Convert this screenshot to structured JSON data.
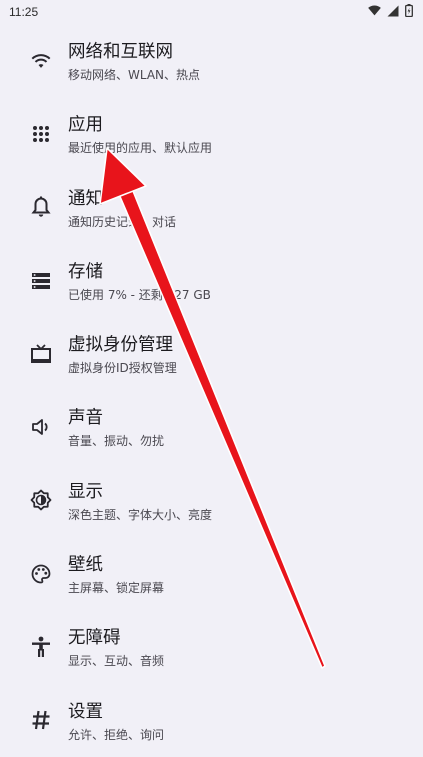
{
  "status_bar": {
    "time": "11:25"
  },
  "settings": [
    {
      "title": "网络和互联网",
      "subtitle": "移动网络、WLAN、热点",
      "icon": "wifi-icon"
    },
    {
      "title": "应用",
      "subtitle": "最近使用的应用、默认应用",
      "icon": "apps-grid-icon"
    },
    {
      "title": "通知",
      "subtitle": "通知历史记录、对话",
      "icon": "bell-icon"
    },
    {
      "title": "存储",
      "subtitle": "已使用 7% - 还剩 127 GB",
      "icon": "storage-icon"
    },
    {
      "title": "虚拟身份管理",
      "subtitle": "虚拟身份ID授权管理",
      "icon": "tv-icon"
    },
    {
      "title": "声音",
      "subtitle": "音量、振动、勿扰",
      "icon": "speaker-icon"
    },
    {
      "title": "显示",
      "subtitle": "深色主题、字体大小、亮度",
      "icon": "brightness-icon"
    },
    {
      "title": "壁纸",
      "subtitle": "主屏幕、锁定屏幕",
      "icon": "palette-icon"
    },
    {
      "title": "无障碍",
      "subtitle": "显示、互动、音频",
      "icon": "accessibility-icon"
    },
    {
      "title": "设置",
      "subtitle": "允许、拒绝、询问",
      "icon": "hash-icon"
    }
  ],
  "annotation": {
    "color": "#e8141b"
  }
}
